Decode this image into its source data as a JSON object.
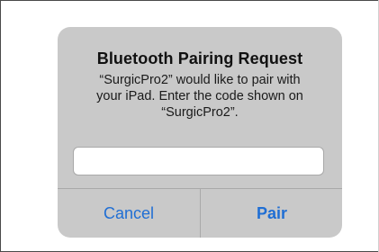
{
  "dialog": {
    "title": "Bluetooth Pairing Request",
    "message": "“SurgicPro2” would like to pair with\nyour iPad. Enter the code shown on\n“SurgicPro2”.",
    "code_input": {
      "value": "",
      "placeholder": ""
    },
    "cancel_label": "Cancel",
    "pair_label": "Pair"
  },
  "colors": {
    "dialog_background": "#c9c9c9",
    "button_text": "#1f6ed4",
    "divider": "#a9a9a9"
  }
}
